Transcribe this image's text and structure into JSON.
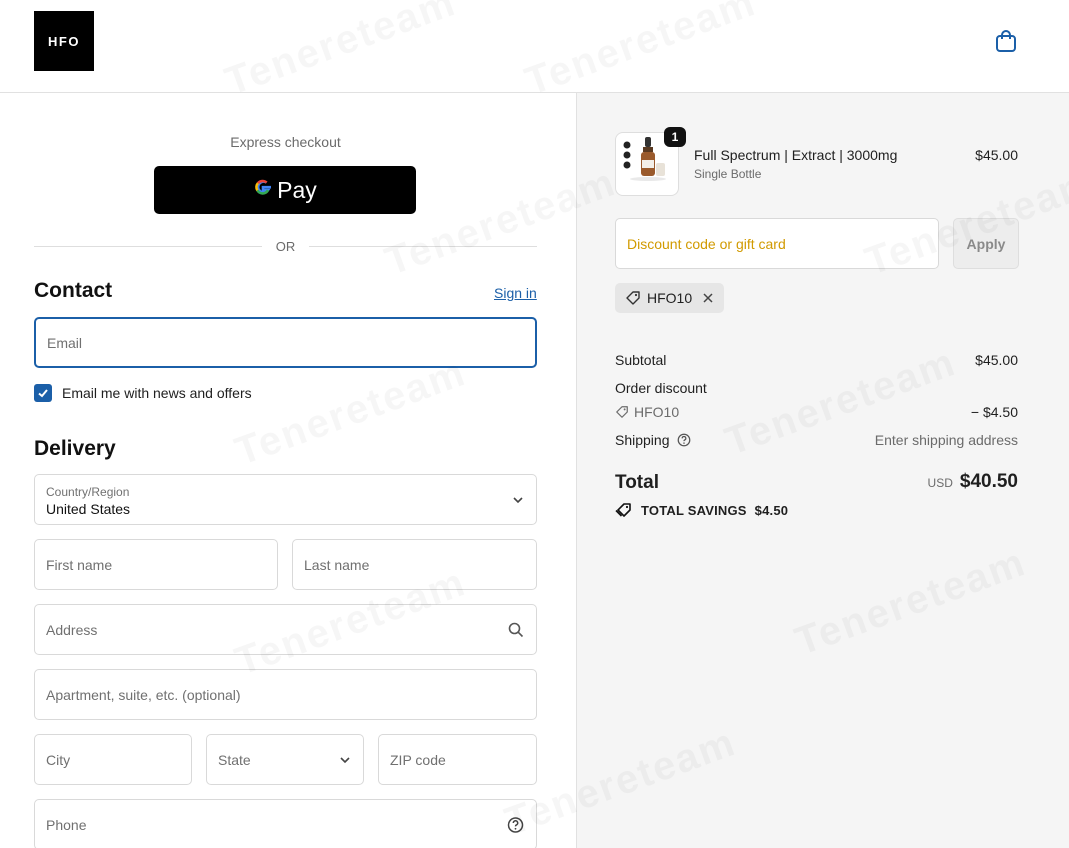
{
  "header": {
    "logo_text": "HFO",
    "cart_icon": "shopping-bag-icon"
  },
  "express": {
    "label": "Express checkout",
    "gpay_g": "G",
    "gpay_label": "Pay",
    "or_label": "OR"
  },
  "contact": {
    "title": "Contact",
    "sign_in": "Sign in",
    "email_placeholder": "Email",
    "newsletter_label": "Email me with news and offers",
    "newsletter_checked": true
  },
  "delivery": {
    "title": "Delivery",
    "country_label": "Country/Region",
    "country_value": "United States",
    "first_name": "First name",
    "last_name": "Last name",
    "address": "Address",
    "apartment": "Apartment, suite, etc. (optional)",
    "city": "City",
    "state": "State",
    "zip": "ZIP code",
    "phone": "Phone"
  },
  "order": {
    "item": {
      "quantity": "1",
      "name": "Full Spectrum | Extract | 3000mg",
      "variant": "Single Bottle",
      "price": "$45.00"
    },
    "discount_placeholder": "Discount code or gift card",
    "apply_label": "Apply",
    "applied_code": "HFO10",
    "subtotal_label": "Subtotal",
    "subtotal_value": "$45.00",
    "order_discount_label": "Order discount",
    "discount_code": "HFO10",
    "discount_value": "− $4.50",
    "shipping_label": "Shipping",
    "shipping_value": "Enter shipping address",
    "total_label": "Total",
    "currency": "USD",
    "total_value": "$40.50",
    "savings_label": "TOTAL SAVINGS",
    "savings_value": "$4.50"
  },
  "watermark": "Tenereteam",
  "colors": {
    "accent": "#1b5fa8",
    "discount_placeholder": "#d19a00",
    "summary_bg": "#f5f5f5"
  }
}
